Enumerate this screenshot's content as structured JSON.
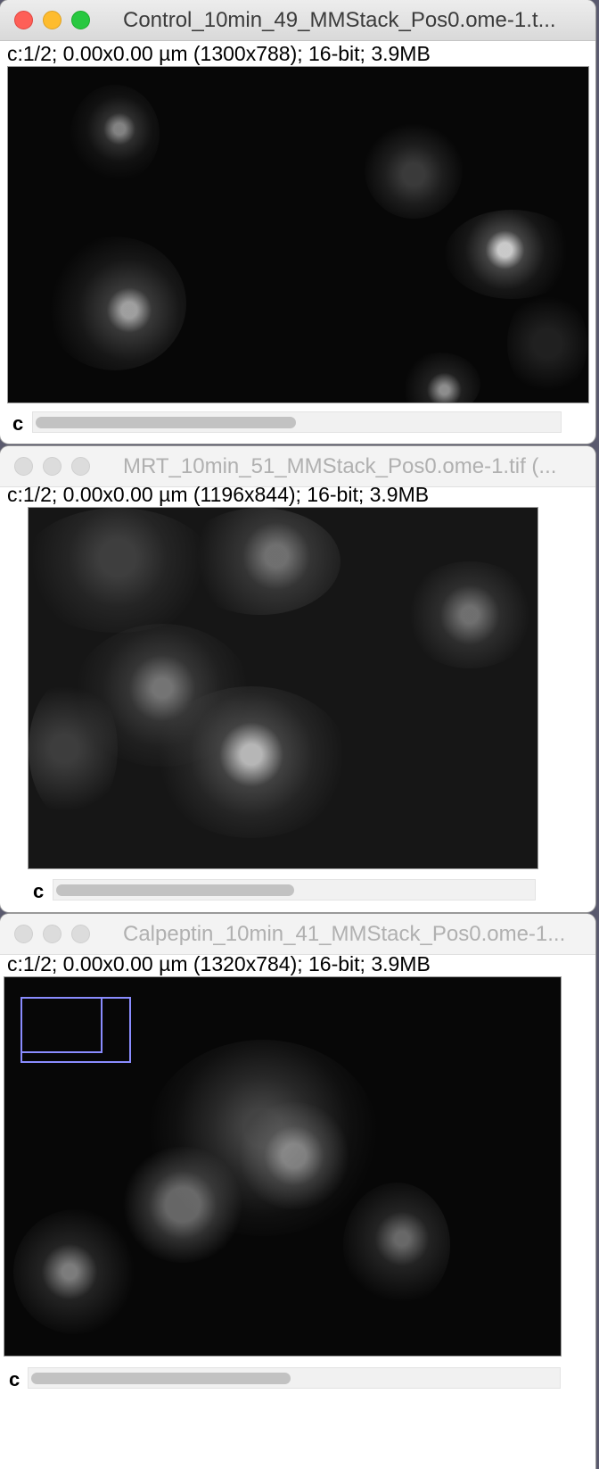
{
  "windows": [
    {
      "title": "Control_10min_49_MMStack_Pos0.ome-1.t...",
      "info": "c:1/2; 0.00x0.00 µm (1300x788); 16-bit; 3.9MB",
      "channel_label": "c",
      "channel_slider_position": 0.0,
      "active": true
    },
    {
      "title": "MRT_10min_51_MMStack_Pos0.ome-1.tif (...",
      "info": "c:1/2; 0.00x0.00 µm (1196x844); 16-bit; 3.9MB",
      "channel_label": "c",
      "channel_slider_position": 0.0,
      "active": false
    },
    {
      "title": "Calpeptin_10min_41_MMStack_Pos0.ome-1...",
      "info": "c:1/2; 0.00x0.00 µm (1320x784); 16-bit; 3.9MB",
      "channel_label": "c",
      "channel_slider_position": 0.0,
      "active": false
    }
  ],
  "colors": {
    "close": "#fe5f57",
    "minimize": "#febc2e",
    "zoom": "#28c840",
    "roi": "#8a8cff",
    "image_background": "#070707"
  }
}
